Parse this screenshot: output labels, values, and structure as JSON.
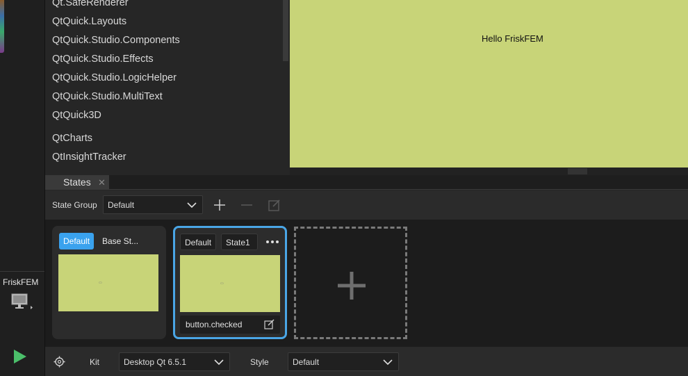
{
  "sidebar": {
    "project_name": "FriskFEM",
    "device_icon": "monitor-icon",
    "run_icon": "play-icon"
  },
  "library": {
    "items": [
      "Qt.SafeRenderer",
      "QtQuick.Layouts",
      "QtQuick.Studio.Components",
      "QtQuick.Studio.Effects",
      "QtQuick.Studio.LogicHelper",
      "QtQuick.Studio.MultiText",
      "QtQuick3D",
      "QtCharts",
      "QtInsightTracker"
    ]
  },
  "canvas": {
    "text": "Hello FriskFEM",
    "background": "#c8d478"
  },
  "states_panel": {
    "tab_label": "States",
    "state_group_label": "State Group",
    "state_group_value": "Default",
    "icons": [
      "plus-icon",
      "minus-icon",
      "edit-icon"
    ],
    "cards": [
      {
        "default_chip": "Default",
        "name": "Base St...",
        "is_base": true
      },
      {
        "default_chip": "Default",
        "name": "State1",
        "when": "button.checked",
        "selected": true
      }
    ],
    "add_state_icon": "plus-icon",
    "accent": "#3aa2ee"
  },
  "statusbar": {
    "kit_label": "Kit",
    "kit_value": "Desktop Qt 6.5.1",
    "style_label": "Style",
    "style_value": "Default",
    "settings_icon": "gear-icon"
  }
}
